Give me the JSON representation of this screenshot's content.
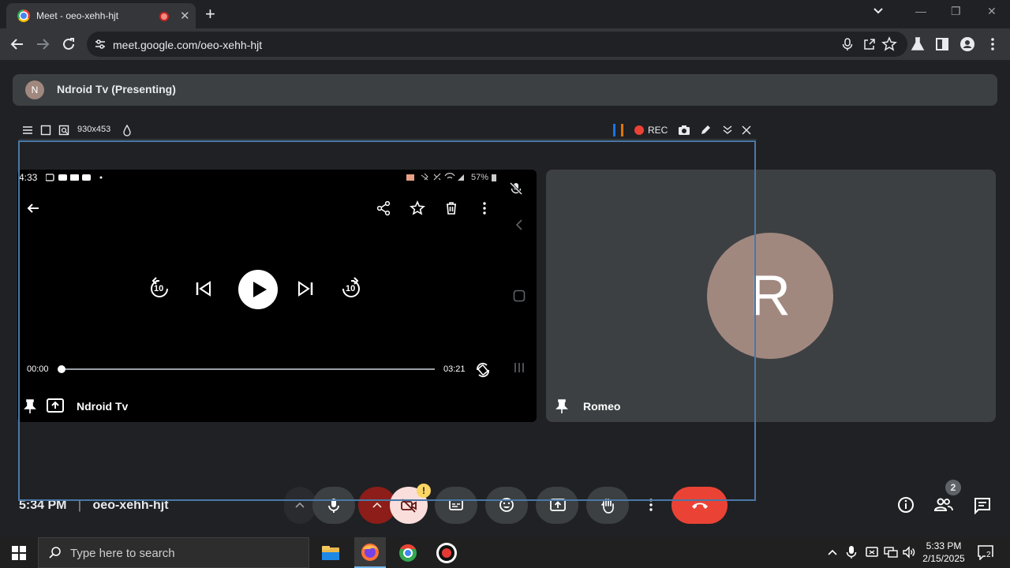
{
  "browser": {
    "tab_title": "Meet - oeo-xehh-hjt",
    "url": "meet.google.com/oeo-xehh-hjt"
  },
  "meet": {
    "presenter_initial": "N",
    "presenting_label": "Ndroid Tv (Presenting)",
    "capture_toolbar": {
      "dimensions": "930x453",
      "rec_label": "REC"
    },
    "phone": {
      "time": "4:33",
      "battery": "57%",
      "elapsed": "00:00",
      "duration": "03:21",
      "progress": 0.0,
      "seek_back_seconds": "10",
      "seek_forward_seconds": "10"
    },
    "tiles": {
      "main_name": "Ndroid Tv",
      "romeo_name": "Romeo",
      "romeo_initial": "R"
    },
    "footer": {
      "time": "5:34 PM",
      "meeting_code": "oeo-xehh-hjt",
      "people_count": "2",
      "camera_warning": "!"
    },
    "colors": {
      "end_call": "#ea4335",
      "accent_avatar": "#a1887f",
      "capture_border": "#4a78a8"
    }
  },
  "taskbar": {
    "search_placeholder": "Type here to search",
    "time": "5:33 PM",
    "date": "2/15/2025",
    "notification_count": "2"
  }
}
